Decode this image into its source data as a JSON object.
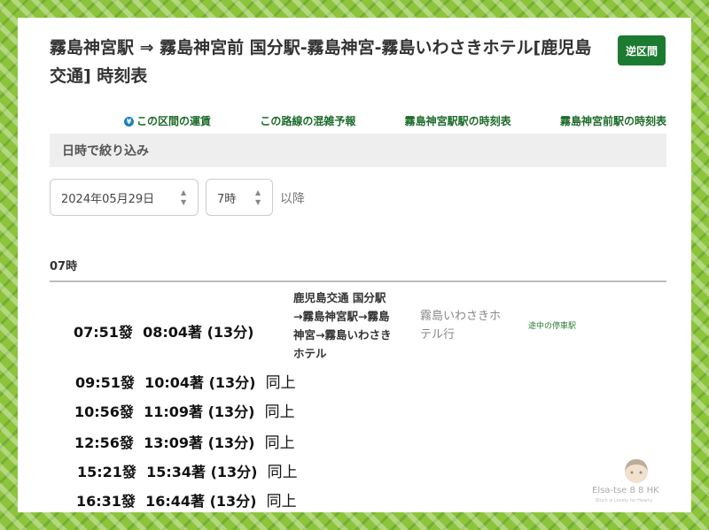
{
  "header": {
    "title": "霧島神宮駅 ⇒ 霧島神宮前 国分駅-霧島神宮-霧島いわさきホテル[鹿児島交通] 時刻表",
    "reverse_label": "逆区間"
  },
  "links": {
    "fare": "この区間の運賃",
    "congestion": "この路線の混雑予報",
    "from_station_timetable": "霧島神宮駅駅の時刻表",
    "to_station_timetable": "霧島神宮前駅の時刻表"
  },
  "filter": {
    "heading": "日時で絞り込み",
    "date": "2024年05月29日",
    "hour": "7時",
    "after": "以降"
  },
  "timetable": {
    "hour_heading": "07時",
    "first": {
      "departure": "07:51發",
      "arrival": "08:04著",
      "duration": "(13分)",
      "route_line1": "鹿児島交通 国分駅",
      "route_line2": "→霧島神宮駅→霧島",
      "route_line3": "神宮→霧島いわさき",
      "route_line4": "ホテル",
      "dest_line1": "霧島いわさきホ",
      "dest_line2": "テル行",
      "stops_link": "途中の停車駅"
    },
    "rows": [
      {
        "departure": "09:51發",
        "arrival": "10:04著",
        "duration": "(13分)",
        "same": "同上"
      },
      {
        "departure": "10:56發",
        "arrival": "11:09著",
        "duration": "(13分)",
        "same": "同上"
      },
      {
        "departure": "12:56發",
        "arrival": "13:09著",
        "duration": "(13分)",
        "same": "同上"
      },
      {
        "departure": "15:21發",
        "arrival": "15:34著",
        "duration": "(13分)",
        "same": "同上"
      },
      {
        "departure": "16:31發",
        "arrival": "16:44著",
        "duration": "(13分)",
        "same": "同上"
      }
    ]
  },
  "watermark": {
    "text": "Elsa-tse 8 8   HK",
    "sub": "Bloch is Lovely for Hearty"
  },
  "colors": {
    "border": "#8cc43c",
    "accent": "#1d7a31"
  }
}
